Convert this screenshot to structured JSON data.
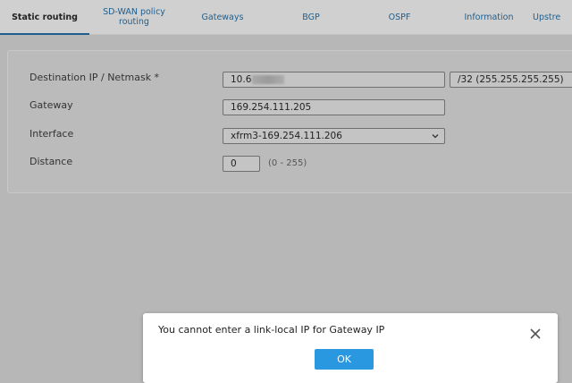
{
  "tabs": [
    {
      "label": "Static routing",
      "active": true
    },
    {
      "label": "SD-WAN policy routing"
    },
    {
      "label": "Gateways"
    },
    {
      "label": "BGP"
    },
    {
      "label": "OSPF"
    },
    {
      "label": "Information"
    },
    {
      "label": "Upstre"
    }
  ],
  "form": {
    "destination_label": "Destination IP / Netmask *",
    "destination_value": "10.6",
    "netmask_value": "/32 (255.255.255.255)",
    "gateway_label": "Gateway",
    "gateway_value": "169.254.111.205",
    "interface_label": "Interface",
    "interface_value": "xfrm3-169.254.111.206",
    "distance_label": "Distance",
    "distance_value": "0",
    "distance_range": "(0 - 255)"
  },
  "dialog": {
    "message": "You cannot enter a link-local IP for Gateway IP",
    "ok_label": "OK"
  },
  "colors": {
    "tab_link": "#1e5f8f",
    "ok_button": "#2a98e0",
    "backdrop": "#b7b7b7"
  }
}
